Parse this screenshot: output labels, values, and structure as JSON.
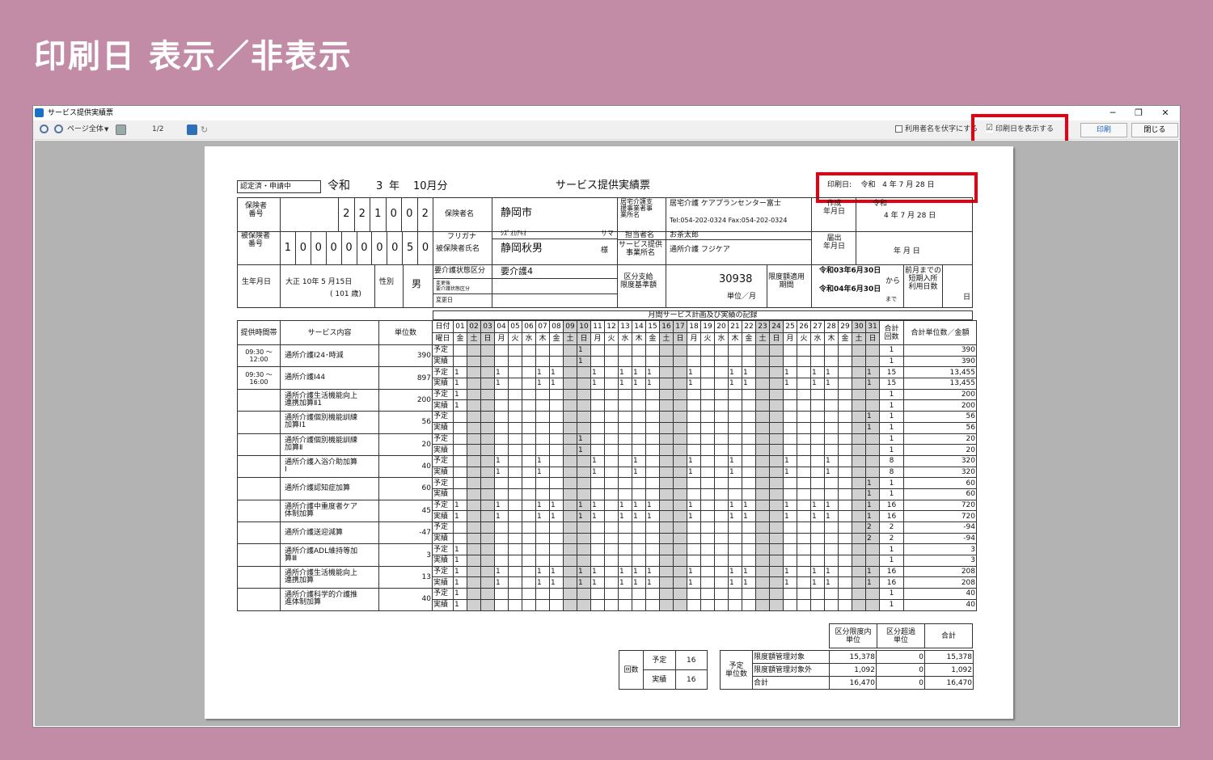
{
  "headline": "印刷日 表示／非表示",
  "window": {
    "title": "サービス提供実績票",
    "controls": [
      "─",
      "❐",
      "✕"
    ]
  },
  "toolbar": {
    "zoom_label": "ページ全体",
    "page": "1/2",
    "mask_name": "利用者名を伏字にする",
    "show_print_date": "印刷日を表示する",
    "checkmark": "☑",
    "print": "印刷",
    "close": "閉じる"
  },
  "form": {
    "status": "認定済・申請中",
    "era": "令和",
    "year": "3",
    "year_unit": "年",
    "month": "10月分",
    "title": "サービス提供実績票",
    "print_date": {
      "label": "印刷日:",
      "era": "令和",
      "y": "4",
      "m": "7",
      "d": "28",
      "yl": "年",
      "ml": "月",
      "dl": "日"
    },
    "insurer_label": "保険者\n番号",
    "insurer_no": [
      "2",
      "2",
      "1",
      "0",
      "0",
      "2"
    ],
    "insurer_name_label": "保険者名",
    "insurer_name": "静岡市",
    "care_office_label": "居宅介護支\n援事業者事\n業所名",
    "care_office": "居宅介護 ケアプランセンター富士",
    "care_office_tel": "Tel:054-202-0324 Fax:054-202-0324",
    "created_label": "作成\n年月日",
    "created_era": "令和",
    "created_date": "4 年 7 月 28 日",
    "insured_label": "被保険者\n番号",
    "insured_no": [
      "1",
      "0",
      "0",
      "0",
      "0",
      "0",
      "0",
      "0",
      "5",
      "0"
    ],
    "kana_label": "フリガナ",
    "kana": "ｼｽﾞｵｶｱｷｵ",
    "kana_suffix": "サマ",
    "name_label": "被保険者氏名",
    "name": "静岡秋男",
    "name_suffix": "様",
    "manager_label": "担当者名",
    "manager": "お茶太郎",
    "provider_label": "サービス提供\n事業所名",
    "provider": "通所介護 フジケア",
    "notify_label": "届出\n年月日",
    "notify_date": "年 月 日",
    "birth_label": "生年月日",
    "birth": "大正 10年 5 月15日",
    "age": "( 101 歳)",
    "sex_label": "性別",
    "sex": "男",
    "care_level_label": "要介護状態区分",
    "care_level": "要介護4",
    "changed_label": "変更後\n要介護状態区分",
    "changed_date_label": "変更日",
    "limit_label": "区分支給\n限度基準額",
    "limit": "30938",
    "limit_unit": "単位／月",
    "period_label": "限度額適用\n期間",
    "period_from": "令和03年6月30日",
    "period_to": "令和04年6月30日",
    "from": "から",
    "to": "まで",
    "short_label": "前月までの\n短期入所\n利用日数",
    "short_unit": "日",
    "record_title": "月間サービス計画及び実績の記録",
    "col_time": "提供時間帯",
    "col_service": "サービス内容",
    "col_units": "単位数",
    "day_label": "日付",
    "dow_label": "曜日",
    "col_count": "合計\n回数",
    "col_total": "合計単位数／金額",
    "days": [
      "01",
      "02",
      "03",
      "04",
      "05",
      "06",
      "07",
      "08",
      "09",
      "10",
      "11",
      "12",
      "13",
      "14",
      "15",
      "16",
      "17",
      "18",
      "19",
      "20",
      "21",
      "22",
      "23",
      "24",
      "25",
      "26",
      "27",
      "28",
      "29",
      "30",
      "31"
    ],
    "dows": [
      "金",
      "土",
      "日",
      "月",
      "火",
      "水",
      "木",
      "金",
      "土",
      "日",
      "月",
      "火",
      "水",
      "木",
      "金",
      "土",
      "日",
      "月",
      "火",
      "水",
      "木",
      "金",
      "土",
      "日",
      "月",
      "火",
      "水",
      "木",
      "金",
      "土",
      "日"
    ],
    "shade_days": [
      2,
      3,
      9,
      10,
      16,
      17,
      23,
      24,
      30,
      31
    ],
    "plan": "予定",
    "actual": "実績",
    "services": [
      {
        "time": "09:30 ～\n12:00",
        "name": "通所介護Ⅰ24･時減",
        "units": "390",
        "plan_days": [
          10
        ],
        "act_days": [
          10
        ],
        "plan_cnt": "1",
        "act_cnt": "1",
        "plan_amt": "390",
        "act_amt": "390"
      },
      {
        "time": "09:30 ～\n16:00",
        "name": "通所介護Ⅰ44",
        "units": "897",
        "plan_days": [
          1,
          4,
          7,
          8,
          11,
          13,
          14,
          15,
          18,
          21,
          22,
          25,
          27,
          28,
          31
        ],
        "act_days": [
          1,
          4,
          7,
          8,
          11,
          13,
          14,
          15,
          18,
          21,
          22,
          25,
          27,
          28,
          31
        ],
        "plan_cnt": "15",
        "act_cnt": "15",
        "plan_amt": "13,455",
        "act_amt": "13,455"
      },
      {
        "time": "",
        "name": "通所介護生活機能向上\n連携加算Ⅱ1",
        "units": "200",
        "plan_days": [
          1
        ],
        "act_days": [
          1
        ],
        "plan_cnt": "1",
        "act_cnt": "1",
        "plan_amt": "200",
        "act_amt": "200"
      },
      {
        "time": "",
        "name": "通所介護個別機能訓練\n加算Ⅰ1",
        "units": "56",
        "plan_days": [
          31
        ],
        "act_days": [
          31
        ],
        "plan_cnt": "1",
        "act_cnt": "1",
        "plan_amt": "56",
        "act_amt": "56"
      },
      {
        "time": "",
        "name": "通所介護個別機能訓練\n加算Ⅱ",
        "units": "20",
        "plan_days": [
          10
        ],
        "act_days": [
          10
        ],
        "plan_cnt": "1",
        "act_cnt": "1",
        "plan_amt": "20",
        "act_amt": "20"
      },
      {
        "time": "",
        "name": "通所介護入浴介助加算\nⅠ",
        "units": "40",
        "plan_days": [
          4,
          7,
          11,
          14,
          18,
          21,
          25,
          28
        ],
        "act_days": [
          4,
          7,
          11,
          14,
          18,
          21,
          25,
          28
        ],
        "plan_cnt": "8",
        "act_cnt": "8",
        "plan_amt": "320",
        "act_amt": "320"
      },
      {
        "time": "",
        "name": "通所介護認知症加算",
        "units": "60",
        "plan_days": [
          31
        ],
        "act_days": [
          31
        ],
        "plan_cnt": "1",
        "act_cnt": "1",
        "plan_amt": "60",
        "act_amt": "60"
      },
      {
        "time": "",
        "name": "通所介護中重度者ケア\n体制加算",
        "units": "45",
        "plan_days": [
          1,
          4,
          7,
          8,
          10,
          11,
          13,
          14,
          15,
          18,
          21,
          22,
          25,
          27,
          28,
          31
        ],
        "act_days": [
          1,
          4,
          7,
          8,
          10,
          11,
          13,
          14,
          15,
          18,
          21,
          22,
          25,
          27,
          28,
          31
        ],
        "plan_cnt": "16",
        "act_cnt": "16",
        "plan_amt": "720",
        "act_amt": "720"
      },
      {
        "time": "",
        "name": "通所介護送迎減算",
        "units": "-47",
        "plan_days": [
          31
        ],
        "act_days": [
          31
        ],
        "plan_cnt": "2",
        "act_cnt": "2",
        "plan_mark": "2",
        "act_mark": "2",
        "plan_amt": "-94",
        "act_amt": "-94"
      },
      {
        "time": "",
        "name": "通所介護ADL維持等加\n算Ⅲ",
        "units": "3",
        "plan_days": [
          1
        ],
        "act_days": [
          1
        ],
        "plan_cnt": "1",
        "act_cnt": "1",
        "plan_amt": "3",
        "act_amt": "3"
      },
      {
        "time": "",
        "name": "通所介護生活機能向上\n連携加算",
        "units": "13",
        "plan_days": [
          1,
          4,
          7,
          8,
          10,
          11,
          13,
          14,
          15,
          18,
          21,
          22,
          25,
          27,
          28,
          31
        ],
        "act_days": [
          1,
          4,
          7,
          8,
          10,
          11,
          13,
          14,
          15,
          18,
          21,
          22,
          25,
          27,
          28,
          31
        ],
        "plan_cnt": "16",
        "act_cnt": "16",
        "plan_amt": "208",
        "act_amt": "208"
      },
      {
        "time": "",
        "name": "通所介護科学的介護推\n進体制加算",
        "units": "40",
        "plan_days": [
          1
        ],
        "act_days": [
          1
        ],
        "plan_cnt": "1",
        "act_cnt": "1",
        "plan_amt": "40",
        "act_amt": "40"
      }
    ],
    "summary": {
      "within": "区分限度内\n単位",
      "over": "区分超過\n単位",
      "total": "合計",
      "count_label": "回数",
      "plan": "予定",
      "actual": "実績",
      "plan_count": "16",
      "act_count": "16",
      "plan_units_label": "予定\n単位数",
      "rows": [
        {
          "label": "限度額管理対象",
          "within": "15,378",
          "over": "0",
          "total": "15,378"
        },
        {
          "label": "限度額管理対象外",
          "within": "1,092",
          "over": "0",
          "total": "1,092"
        },
        {
          "label": "合計",
          "within": "16,470",
          "over": "0",
          "total": "16,470"
        }
      ]
    }
  }
}
